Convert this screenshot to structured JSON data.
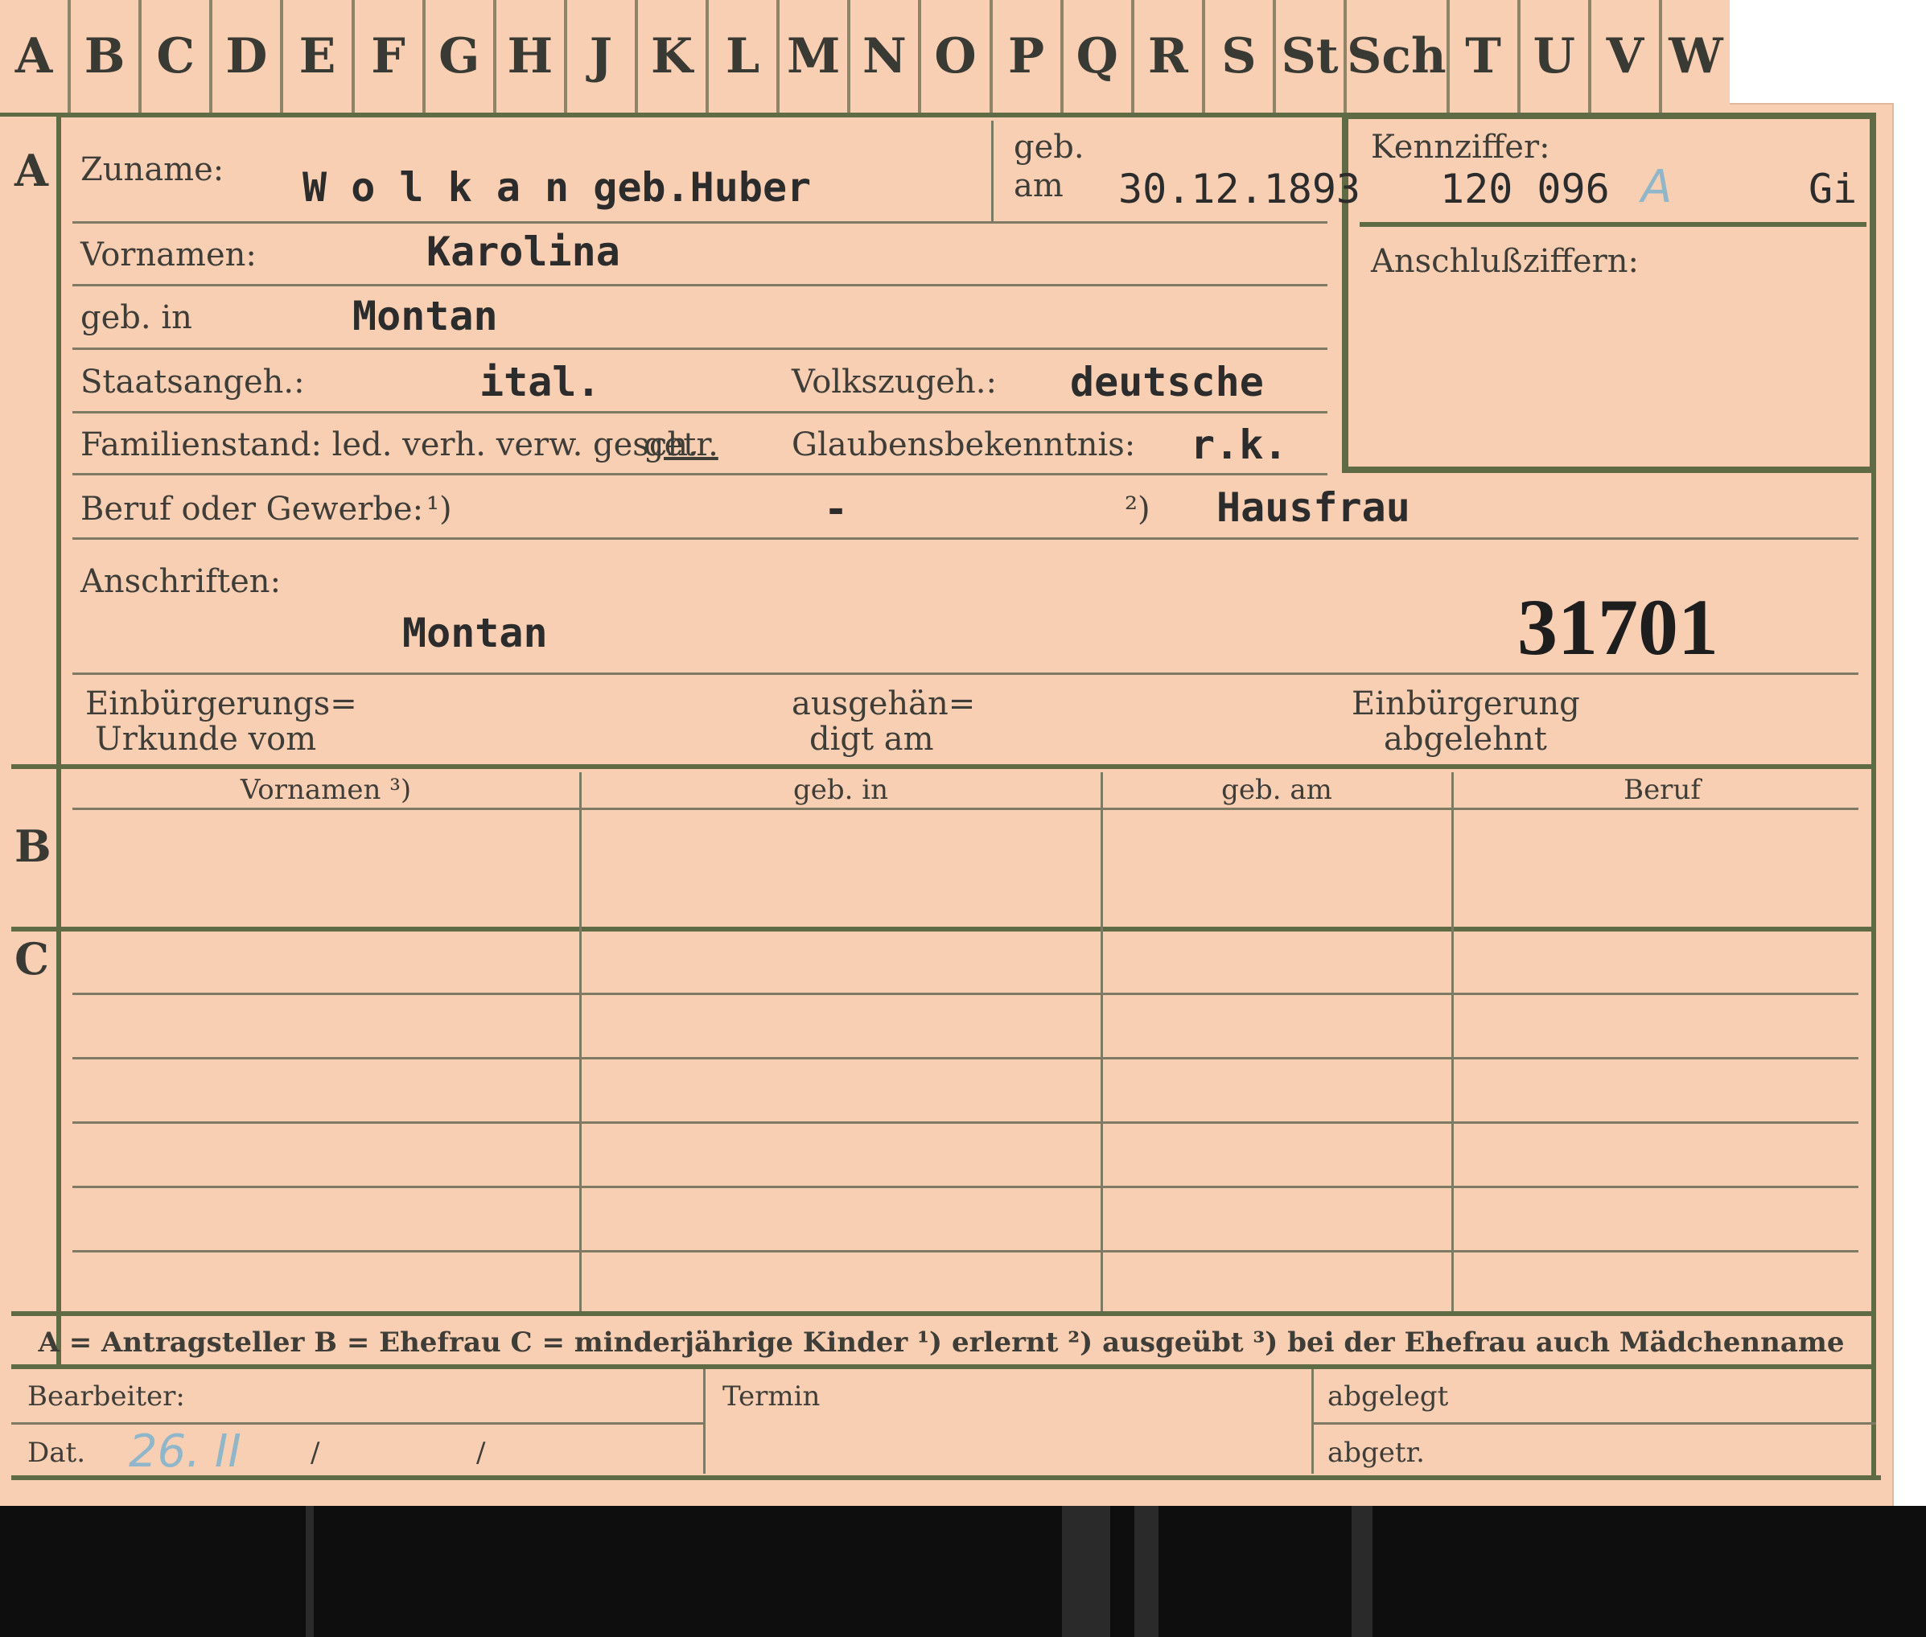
{
  "tabs": [
    "A",
    "B",
    "C",
    "D",
    "E",
    "F",
    "G",
    "H",
    "J",
    "K",
    "L",
    "M",
    "N",
    "O",
    "P",
    "Q",
    "R",
    "S",
    "St",
    "Sch",
    "T",
    "U",
    "V",
    "W"
  ],
  "sections": {
    "a": "A",
    "b": "B",
    "c": "C"
  },
  "labels": {
    "zuname": "Zuname:",
    "geb": "geb.",
    "am": "am",
    "kennziffer": "Kennziffer:",
    "anschlussziffern": "Anschlußziffern:",
    "vornamen": "Vornamen:",
    "geb_in": "geb. in",
    "staatsangeh": "Staatsangeh.:",
    "volkszugeh": "Volkszugeh.:",
    "familienstand": "Familienstand: led. verh. verw. gesch.",
    "getr": "getr.",
    "glaubensbekenntnis": "Glaubensbekenntnis:",
    "beruf": "Beruf oder Gewerbe:",
    "fn1": "¹)",
    "fn2": "²)",
    "anschriften": "Anschriften:",
    "einb_urkunde_1": "Einbürgerungs=",
    "einb_urkunde_2": "Urkunde vom",
    "ausgehaen_1": "ausgehän=",
    "ausgehaen_2": "digt am",
    "einb_abgelehnt_1": "Einbürgerung",
    "einb_abgelehnt_2": "abgelehnt",
    "col_vornamen": "Vornamen ³)",
    "col_geb_in": "geb. in",
    "col_geb_am": "geb. am",
    "col_beruf": "Beruf",
    "footnote": "A = Antragsteller   B = Ehefrau   C = minderjährige Kinder   ¹) erlernt   ²) ausgeübt   ³) bei der Ehefrau auch Mädchenname",
    "bearbeiter": "Bearbeiter:",
    "termin": "Termin",
    "abgelegt": "abgelegt",
    "dat": "Dat.",
    "slash1": "/",
    "slash2": "/",
    "abgetr": "abgetr."
  },
  "values": {
    "zuname": "W o l k a n geb.Huber",
    "geb_am": "30.12.1893",
    "kennziffer": "120 096",
    "kennziffer_suffix": "Gi",
    "kennziffer_mark": "A",
    "vornamen": "Karolina",
    "geb_in": "Montan",
    "staatsangeh": "ital.",
    "volkszugeh": "deutsche",
    "glaubensbekenntnis": "r.k.",
    "beruf_erlernt": "-",
    "beruf_ausgeuebt": "Hausfrau",
    "anschrift": "Montan",
    "card_number": "31701",
    "dat_handwritten": "26. II"
  },
  "colors": {
    "card": "#f8cfb3",
    "frame": "#5e6b45",
    "ink": "#2c2c2c",
    "pencil": "#8fb7c9"
  }
}
